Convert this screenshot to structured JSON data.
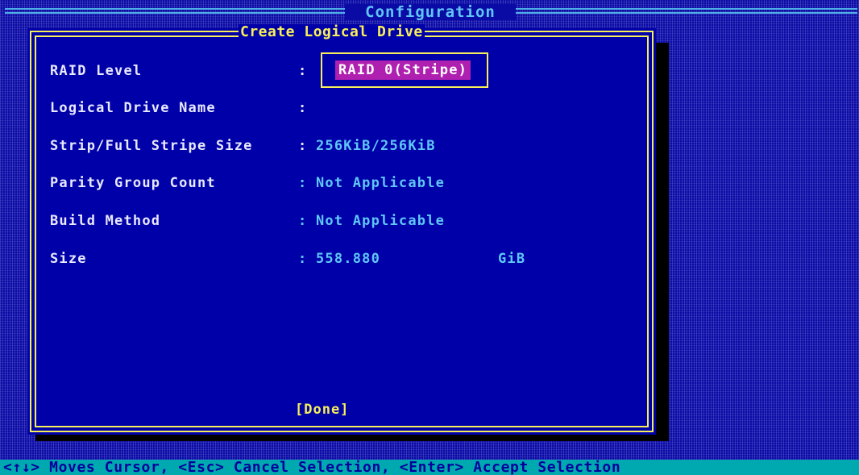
{
  "screen": {
    "title": "Configuration"
  },
  "dialog": {
    "title": "Create Logical Drive",
    "fields": [
      {
        "label": "RAID Level",
        "colon": ":",
        "value": "RAID 0(Stripe)"
      },
      {
        "label": "Logical Drive Name",
        "colon": ":",
        "value": ""
      },
      {
        "label": "Strip/Full Stripe Size",
        "colon": ":",
        "value": "256KiB/256KiB"
      },
      {
        "label": "Parity Group Count",
        "colon": ":",
        "value": "Not Applicable"
      },
      {
        "label": "Build Method",
        "colon": ":",
        "value": "Not Applicable"
      },
      {
        "label": "Size",
        "colon": ":",
        "value": "558.880",
        "unit": "GiB"
      }
    ],
    "done_label": "[Done]"
  },
  "status_bar": {
    "text": "<↑↓> Moves Cursor, <Esc> Cancel Selection, <Enter> Accept Selection"
  },
  "colors": {
    "background": "#0000a8",
    "border": "#f7ef5a",
    "value_text": "#5fc7f7",
    "selection_highlight": "#b020b0",
    "status_bar_bg": "#00a8b0"
  }
}
